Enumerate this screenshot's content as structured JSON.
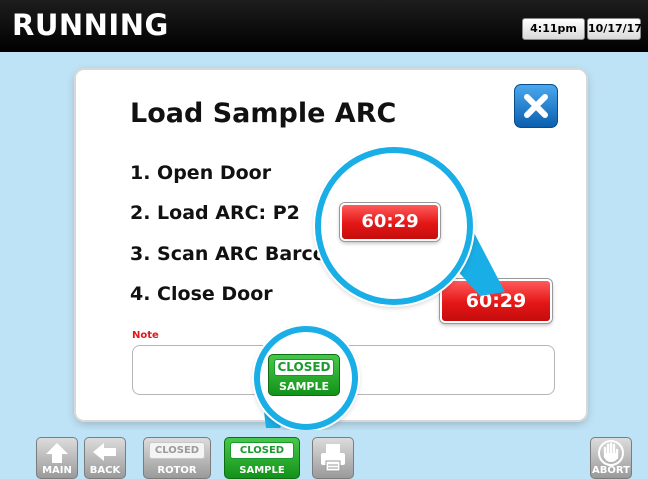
{
  "header": {
    "title": "RUNNING",
    "time": "4:11pm",
    "date": "10/17/17"
  },
  "dialog": {
    "title": "Load Sample ARC",
    "close_icon": "close-x-icon",
    "steps": [
      "1. Open Door",
      "2. Load ARC: P2",
      "3. Scan ARC Barcode",
      "4. Close Door"
    ],
    "note_label": "Note",
    "note_value": "",
    "timer": "60:29"
  },
  "callouts": {
    "timer_zoom": "60:29",
    "sample_zoom_top": "CLOSED",
    "sample_zoom_bottom": "SAMPLE"
  },
  "nav": {
    "main": {
      "label": "MAIN",
      "icon": "up-arrow-icon"
    },
    "back": {
      "label": "BACK",
      "icon": "left-arrow-icon"
    },
    "rotor": {
      "status": "CLOSED",
      "label": "ROTOR"
    },
    "sample": {
      "status": "CLOSED",
      "label": "SAMPLE"
    },
    "print": {
      "icon": "printer-icon"
    },
    "abort": {
      "label": "ABORT",
      "icon": "hand-stop-icon"
    }
  },
  "colors": {
    "accent_blue": "#19aee5",
    "timer_red": "#e41616",
    "status_green": "#1a9a2e",
    "note_red": "#e01818"
  }
}
